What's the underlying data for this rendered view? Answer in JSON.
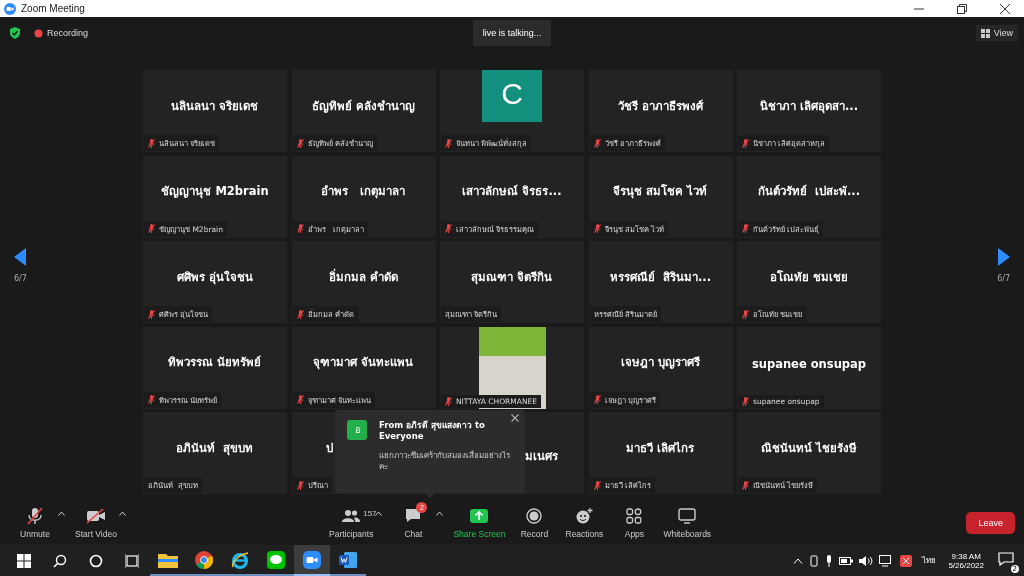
{
  "window": {
    "title": "Zoom Meeting"
  },
  "top_bar": {
    "recording": "Recording",
    "speaker": "live is talking...",
    "view": "View"
  },
  "pager": {
    "left": "6/7",
    "right": "6/7"
  },
  "tiles": [
    {
      "kind": "name",
      "name": "นลินลนา จริยเดช",
      "label": "นลินลนา จริยเดช",
      "muted": true
    },
    {
      "kind": "name",
      "name": "ธัญทิพย์ คลังชำนาญ",
      "label": "ธัญทิพย์ คลังชำนาญ",
      "muted": true
    },
    {
      "kind": "avatar",
      "initial": "C",
      "color": "#138f7e",
      "label": "จันทนา พิพัฒน์ทั่งสกุล",
      "muted": true
    },
    {
      "kind": "name",
      "name": "วัชรี อาภาธีรพงศ์",
      "label": "วัชรี อาภาธีรพงศ์",
      "muted": true
    },
    {
      "kind": "name",
      "name": "นิชาภา เลิศอุดสา...",
      "label": "นิชาภา เลิศอุดสาหกุล",
      "muted": true
    },
    {
      "kind": "name",
      "name": "ชัญญานุช M2brain",
      "label": "ชัญญานุช M2brain",
      "muted": true
    },
    {
      "kind": "name",
      "name": "อำพร   เกตุมาลา",
      "label": "อำพร   เกตุมาลา",
      "muted": true
    },
    {
      "kind": "name",
      "name": "เสาวลักษณ์ จิรธร...",
      "label": "เสาวลักษณ์ จิรธรรมคุณ",
      "muted": true
    },
    {
      "kind": "name",
      "name": "จีรนุช สมโชค ไวท์",
      "label": "จีรนุช สมโชค ไวท์",
      "muted": true
    },
    {
      "kind": "name",
      "name": "กันต์วรัทย์  เปสะพั...",
      "label": "กันต์วรัทย์ เปสะพันธุ์",
      "muted": true
    },
    {
      "kind": "name",
      "name": "ศศิพร อุ่นใจชน",
      "label": "ศศิพร อุ่นใจชน",
      "muted": true
    },
    {
      "kind": "name",
      "name": "อิ่มกมล คำดัด",
      "label": "อิ่มกมล คำดัด",
      "muted": true
    },
    {
      "kind": "name",
      "name": "สุมณฑา จิตรีกิน",
      "label": "สุมณฑา จิตรีกิน",
      "muted": false
    },
    {
      "kind": "name",
      "name": "หรรศณีย์  สิรินมา...",
      "label": "หรรศณีย์ สิรินมาตย์",
      "muted": false
    },
    {
      "kind": "name",
      "name": "อโณทัย ชมเชย",
      "label": "อโณทัย ชมเชย",
      "muted": true
    },
    {
      "kind": "name",
      "name": "ทิพวรรณ นัยทรัพย์",
      "label": "ทิพวรรณ นัยทรัพย์",
      "muted": true
    },
    {
      "kind": "name",
      "name": "จุฑามาศ จันทะแพน",
      "label": "จุฑามาศ จันทะแพน",
      "muted": true
    },
    {
      "kind": "photo",
      "label": "NITTAYA CHORMANEE",
      "muted": true
    },
    {
      "kind": "name",
      "name": "เจษฎา บุญราศรี",
      "label": "เจษฎา บุญราศรี",
      "muted": true
    },
    {
      "kind": "name",
      "name": "supanee onsupap",
      "label": "supanee onsupap",
      "muted": true
    },
    {
      "kind": "name",
      "name": "อภินันท์  สุขบท",
      "label": "อภินันท์  สุขบท",
      "muted": false
    },
    {
      "kind": "leading",
      "name": "ป",
      "label": "ปรีณา",
      "muted": true
    },
    {
      "kind": "trailing",
      "name": "มเนศร"
    },
    {
      "kind": "name",
      "name": "มาธวี เลิศไกร",
      "label": "มาธวี เลิศไกร",
      "muted": true
    },
    {
      "kind": "name",
      "name": "ณิชนันทน์ ไชยรังษี",
      "label": "ณิชนันทน์ ไชยรังษี",
      "muted": true
    }
  ],
  "chat_popup": {
    "avatar": "อ",
    "title": "From อภิรดี สุขแสงดาว to Everyone",
    "message": "แยกภาวะซึมเศร้ากับสมองเสื่อมอย่างไรคะ"
  },
  "toolbar": {
    "items": [
      {
        "kind": "mic",
        "label": "Unmute",
        "caret": true
      },
      {
        "kind": "video",
        "label": "Start Video",
        "caret": true
      },
      {
        "kind": "participants",
        "label": "Participants",
        "count": "157",
        "caret": true
      },
      {
        "kind": "chat",
        "label": "Chat",
        "badge": "2",
        "caret": true
      },
      {
        "kind": "share",
        "label": "Share Screen",
        "caret": false
      },
      {
        "kind": "record",
        "label": "Record",
        "caret": false
      },
      {
        "kind": "reactions",
        "label": "Reactions",
        "caret": false
      },
      {
        "kind": "apps",
        "label": "Apps",
        "caret": false
      },
      {
        "kind": "whiteboards",
        "label": "Whiteboards",
        "caret": false
      }
    ],
    "leave": "Leave"
  },
  "taskbar": {
    "apps": [
      {
        "kind": "explorer",
        "selected": false
      },
      {
        "kind": "chrome",
        "selected": false
      },
      {
        "kind": "ie",
        "selected": false
      },
      {
        "kind": "line",
        "selected": false
      },
      {
        "kind": "zoom",
        "selected": true
      },
      {
        "kind": "word",
        "selected": false
      }
    ],
    "language": "ไทย",
    "time": "9:38 AM",
    "date": "5/26/2022",
    "notifications": "2"
  }
}
